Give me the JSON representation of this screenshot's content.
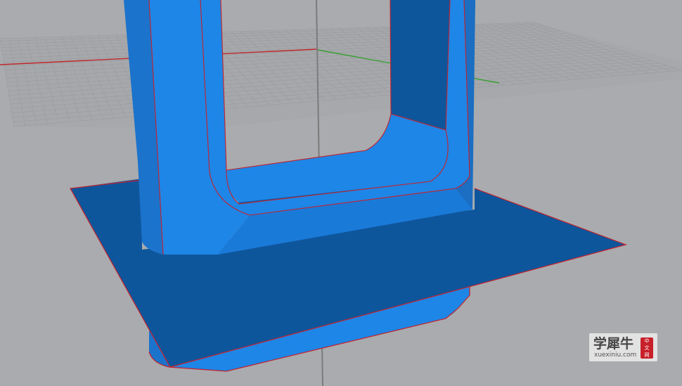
{
  "viewport": {
    "label": "3D perspective viewport",
    "background_color": "#a9abae",
    "grid_color": "#9c9ea1",
    "x_axis_color": "#c0262a",
    "y_axis_color": "#3aa035",
    "z_axis_color": "#7b7b7b"
  },
  "model": {
    "surface_color": "#1e86e6",
    "surface_shade_color": "#1b6ec2",
    "plane_color": "#0e569c",
    "edge_color": "#c8202a"
  },
  "watermark": {
    "text": "学犀牛",
    "domain": "xuexiniu.com",
    "badge": [
      "中",
      "文",
      "网"
    ],
    "badge_color": "#c8202a"
  }
}
